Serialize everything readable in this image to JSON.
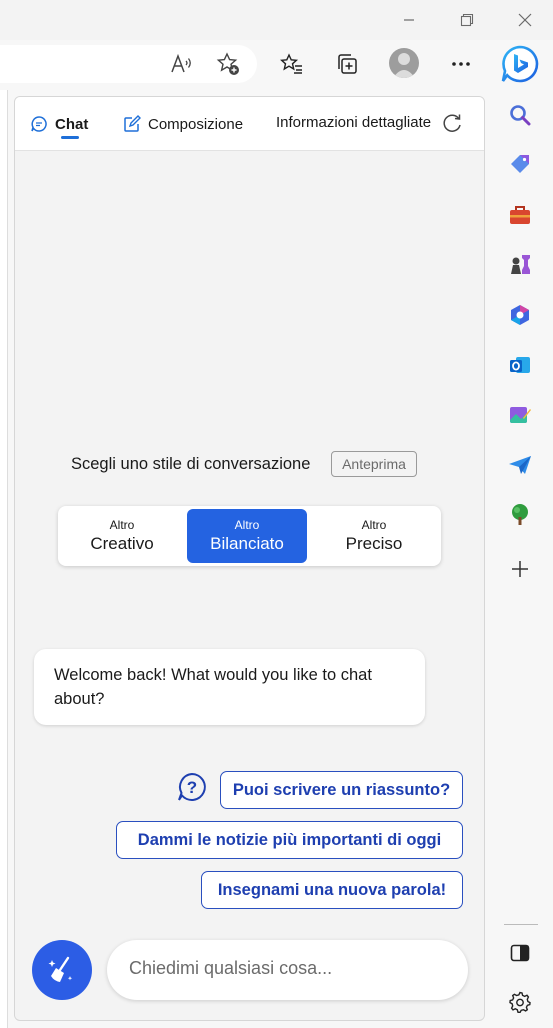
{
  "browser": {
    "icons": [
      "read-aloud-icon",
      "add-favorite-icon",
      "favorites-icon",
      "collections-icon",
      "profile-avatar",
      "more-icon",
      "bing-copilot-icon"
    ]
  },
  "tabs": {
    "chat": "Chat",
    "compose": "Composizione",
    "insights": "Informazioni dettagliate"
  },
  "conversation_style": {
    "label": "Scegli uno stile di conversazione",
    "badge": "Anteprima",
    "options": [
      {
        "small": "Altro",
        "big": "Creativo"
      },
      {
        "small": "Altro",
        "big": "Bilanciato"
      },
      {
        "small": "Altro",
        "big": "Preciso"
      }
    ],
    "selected": "Bilanciato"
  },
  "welcome_message": "Welcome back! What would you like to chat about?",
  "suggestions": [
    "Puoi scrivere un riassunto?",
    "Dammi le notizie più importanti di oggi",
    "Insegnami una nuova parola!"
  ],
  "input": {
    "placeholder": "Chiedimi qualsiasi cosa..."
  },
  "sidebar": {
    "items": [
      "search-icon",
      "shopping-tag-icon",
      "tools-icon",
      "games-icon",
      "microsoft-365-icon",
      "outlook-icon",
      "image-creator-icon",
      "send-telegram-icon",
      "tree-icon",
      "add-icon"
    ],
    "bottom": [
      "split-screen-icon",
      "settings-icon"
    ]
  },
  "colors": {
    "accent": "#2463e1",
    "suggestion_text": "#1e3fb0",
    "panel_bg": "#f3f3f3"
  }
}
